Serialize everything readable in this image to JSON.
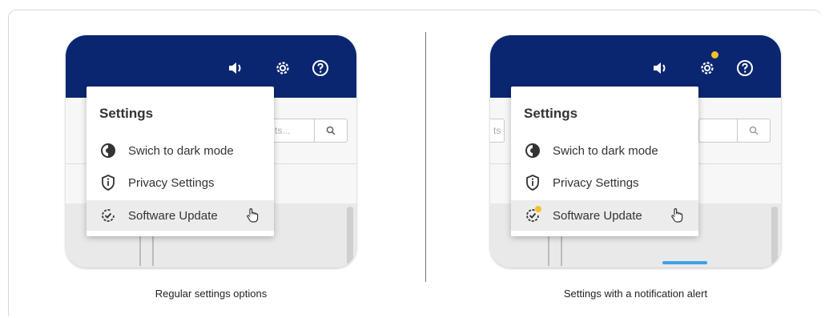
{
  "examples": [
    {
      "menu": {
        "title": "Settings",
        "items": [
          {
            "label": "Swich to dark mode",
            "icon": "contrast-icon"
          },
          {
            "label": "Privacy Settings",
            "icon": "shield-info-icon"
          },
          {
            "label": "Software Update",
            "icon": "update-check-icon"
          }
        ]
      },
      "search_placeholder": "ts...",
      "notification": false,
      "caption": "Regular settings options"
    },
    {
      "menu": {
        "title": "Settings",
        "items": [
          {
            "label": "Swich to dark mode",
            "icon": "contrast-icon"
          },
          {
            "label": "Privacy Settings",
            "icon": "shield-info-icon"
          },
          {
            "label": "Software Update",
            "icon": "update-check-icon"
          }
        ]
      },
      "search_placeholder": "ts",
      "notification": true,
      "caption": "Settings with a notification alert"
    }
  ],
  "colors": {
    "topbar": "#0b2670",
    "notification_dot": "#f2c22c",
    "hover_row": "#ececec"
  }
}
